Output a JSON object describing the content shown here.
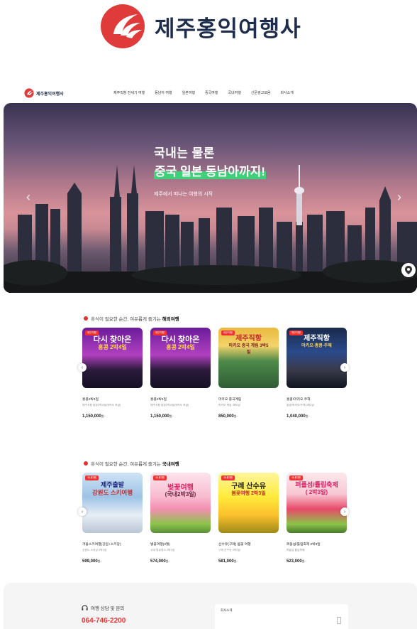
{
  "brand": {
    "name": "제주홍익여행사",
    "color": "#e03b3b"
  },
  "nav": {
    "items": [
      "제주직항 전세기 여행",
      "동남아 여행",
      "일본여행",
      "중국여행",
      "국내여행",
      "신문광고모음",
      "회사소개"
    ]
  },
  "hero": {
    "line1": "국내는 물론",
    "line2": "중국 일본 동남아까지!",
    "subtitle": "제주에서 떠나는 여행의 시작",
    "prev_icon": "chevron-left-icon",
    "next_icon": "chevron-right-icon",
    "pin_icon": "location-pin-icon"
  },
  "overseas": {
    "title_prefix": "휴식이 필요한 순간, 여유롭게 즐기는",
    "title_bold": "해외여행",
    "cards": [
      {
        "tag": "제주직항",
        "headline": "다시 찾아온",
        "headline2": "홍콩 2박4일",
        "name": "홍콩2박4일",
        "desc": "제주직항 홍콩2박4일(마카오 포함)",
        "price": "1,150,000",
        "unit": "원~"
      },
      {
        "tag": "제주직항",
        "headline": "다시 찾아온",
        "headline2": "홍콩 2박4일",
        "name": "홍콩2박4일",
        "desc": "제주직항 홍콩2박4일(마카오 포함)",
        "price": "1,150,000",
        "unit": "원~"
      },
      {
        "tag": "제주직항",
        "headline": "제주직항",
        "headline2": "마카오 중국 계림 3박5일",
        "name": "마카오 중국계림",
        "desc": "마카오 계림 3박5일",
        "price": "850,000",
        "unit": "원~"
      },
      {
        "tag": "제주직항",
        "headline": "제주직항",
        "headline2": "마카오-홍콩-주해",
        "name": "홍콩/마카오 주해",
        "desc": "홍콩/마카오/주해 3박4일",
        "price": "1,040,000",
        "unit": "원~"
      }
    ]
  },
  "domestic": {
    "title_prefix": "휴식이 필요한 순간, 여유롭게 즐기는",
    "title_bold": "국내여행",
    "cards": [
      {
        "tag": "국내여행",
        "headline": "제주출발",
        "headline2": "강원도 스키여행",
        "name": "겨울스키여행(강원+스키장)",
        "desc": "강원도 스키장 2박3일",
        "price": "599,000",
        "unit": "원~"
      },
      {
        "tag": "국내여행",
        "headline": "벚꽃여행",
        "headline2": "(국내2박3일)",
        "name": "벚꽃여행(3월)",
        "desc": "국내 벚꽃명소 2박3일",
        "price": "574,000",
        "unit": "원~"
      },
      {
        "tag": "국내여행",
        "headline": "구례 산수유",
        "headline2": "봄꽃여행 2박3일",
        "name": "산수유(구례) 봄꽃 여행",
        "desc": "구례 산수유 2박3일",
        "price": "581,000",
        "unit": "원~"
      },
      {
        "tag": "국내여행",
        "headline": "퍼플섬/튤립축제",
        "headline2": "( 2박3일)",
        "name": "퍼플섬/튤립축제 2박3일",
        "desc": "퍼플섬 튤립축제",
        "price": "523,000",
        "unit": "원~"
      }
    ]
  },
  "footer": {
    "contact_label": "여행 상담 및 문의",
    "phone": "064-746-2200",
    "company_label": "회사소개"
  }
}
